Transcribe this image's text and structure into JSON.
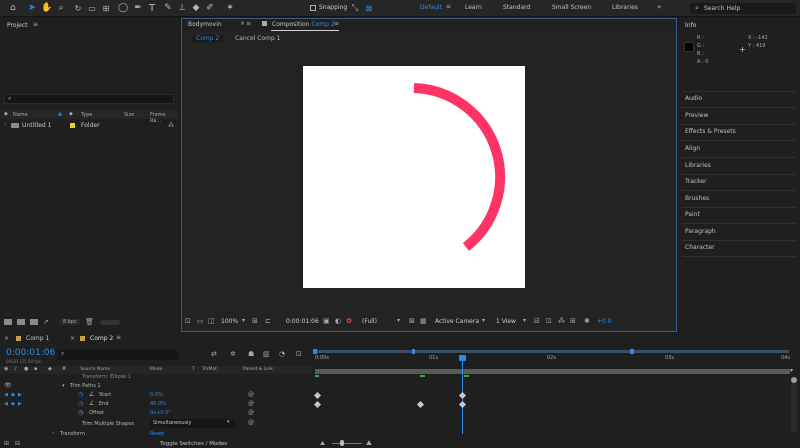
{
  "toolbar": {
    "snapping_label": "Snapping",
    "workspaces": [
      "Default",
      "Learn",
      "Standard",
      "Small Screen",
      "Libraries"
    ],
    "search_placeholder": "Search Help"
  },
  "project": {
    "title": "Project",
    "columns": [
      "Name",
      "Type",
      "Size",
      "Frame Ra..."
    ],
    "items": [
      {
        "name": "Untitled 1",
        "type": "Folder"
      }
    ],
    "bpc": "8 bpc"
  },
  "composition": {
    "tab_bodymovin": "Bodymovin",
    "tab_comp_prefix": "Composition",
    "tab_comp_name": "Comp 2",
    "crumbs": [
      "Comp 2",
      "Cancel Comp 1"
    ],
    "zoom": "100%",
    "timecode": "0:00:01:06",
    "resolution": "(Full)",
    "camera": "Active Camera",
    "view": "1 View",
    "exposure": "+0.0",
    "arc_color": "#ff3465"
  },
  "info": {
    "title": "Info",
    "r": "R :",
    "g": "G :",
    "b": "B :",
    "a": "A :  0",
    "x": "X : -142",
    "y": "Y : 419"
  },
  "side_panels": [
    "Audio",
    "Preview",
    "Effects & Presets",
    "Align",
    "Libraries",
    "Tracker",
    "Brushes",
    "Paint",
    "Paragraph",
    "Character"
  ],
  "timeline": {
    "tabs": [
      "Comp 1",
      "Comp 2"
    ],
    "timecode": "0:00:01:06",
    "fps_text": "00031 (25.00 fps)",
    "columns": [
      "Source Name",
      "Mode",
      "T",
      "TrkMat",
      "Parent & Link"
    ],
    "ticks": [
      "0:00s",
      "01s",
      "02s",
      "03s",
      "04s"
    ],
    "rows": {
      "transform_ellipse": "Transform: Ellipse 1",
      "trim_paths": "Trim Paths 1",
      "start_label": "Start",
      "start_value": "0.0%",
      "end_label": "End",
      "end_value": "40.0%",
      "offset_label": "Offset",
      "offset_value": "0x+0.0°",
      "trim_multiple_label": "Trim Multiple Shapes",
      "trim_multiple_value": "Simultaneously",
      "transform_label": "Transform",
      "transform_value": "Reset"
    },
    "toggle_label": "Toggle Switches / Modes"
  }
}
